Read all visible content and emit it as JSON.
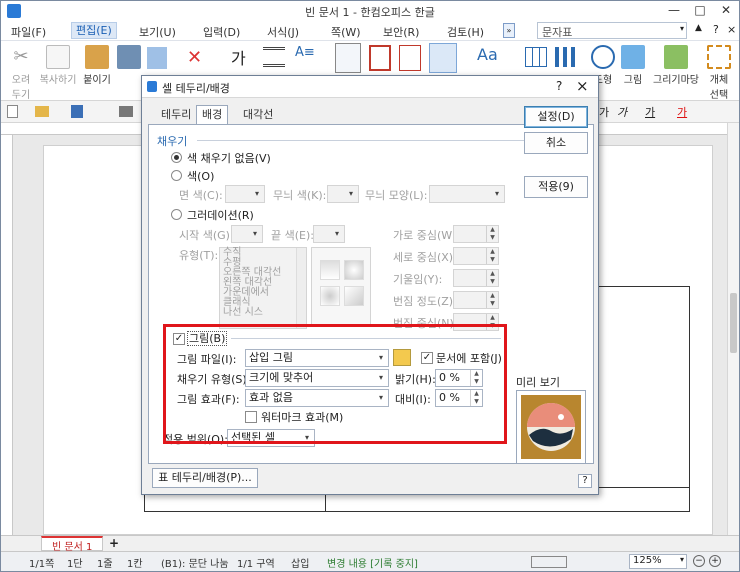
{
  "app": {
    "title": "빈 문서 1 - 한컴오피스 한글"
  },
  "menus": [
    {
      "label": "파일(F)"
    },
    {
      "label": "편집(E)"
    },
    {
      "label": "보기(U)"
    },
    {
      "label": "입력(D)"
    },
    {
      "label": "서식(J)"
    },
    {
      "label": "쪽(W)"
    },
    {
      "label": "보안(R)"
    },
    {
      "label": "검토(H)"
    }
  ],
  "style_box": "문자표",
  "ribbon": {
    "cut": "오려\n두기",
    "copy": "복사하기",
    "paste": "붙이기",
    "format_copy": "모양\n복사",
    "shape": "도형",
    "picture": "그림",
    "drawing": "그리기마당",
    "object_select": "개체\n선택"
  },
  "dialog": {
    "title": "셀 테두리/배경",
    "tabs": [
      {
        "label": "테두리"
      },
      {
        "label": "배경"
      },
      {
        "label": "대각선"
      }
    ],
    "fill_section": "채우기",
    "no_fill": "색 채우기 없음(V)",
    "color_radio": "색(O)",
    "face_color": "면 색(C):",
    "pattern_color": "무늬 색(K):",
    "pattern_shape": "무늬 모양(L):",
    "gradation_radio": "그러데이션(R)",
    "start_color": "시작 색(G):",
    "end_color": "끝 색(E):",
    "horizontal_center": "가로 중심(W):",
    "type_label": "유형(T):",
    "gradation_types": [
      "수직",
      "수평",
      "오른쪽 대각선",
      "왼쪽 대각선",
      "가운데에서",
      "클래식",
      "나선 시스"
    ],
    "vertical_center": "세로 중심(X):",
    "tilt": "기울임(Y):",
    "change_degree": "번짐 정도(Z):",
    "change_center": "번짐 중심(N):",
    "picture_check": "그림(B)",
    "picture_file_label": "그림 파일(I):",
    "picture_file_value": "삽입 그림",
    "include_in_doc": "문서에 포함(J)",
    "fill_type_label": "채우기 유형(S):",
    "fill_type_value": "크기에 맞추어",
    "brightness_label": "밝기(H):",
    "brightness_value": "0 %",
    "picture_effect_label": "그림 효과(F):",
    "picture_effect_value": "효과 없음",
    "contrast_label": "대비(I):",
    "contrast_value": "0 %",
    "watermark": "워터마크 효과(M)",
    "apply_range_label": "적용 범위(O):",
    "apply_range_value": "선택된 셀",
    "preview_label": "미리 보기",
    "table_border_btn": "표 테두리/배경(P)...",
    "set_btn": "설정(D)",
    "cancel_btn": "취소",
    "apply_btn": "적용(9)",
    "help": "?",
    "close": "×"
  },
  "doc_tab": "빈 문서 1",
  "status": {
    "page": "1/1쪽",
    "section": "1단",
    "line": "1줄",
    "col": "1칸",
    "para": "(B1): 문단 나눔",
    "zone": "1/1 구역",
    "insert": "삽입",
    "track": "변경 내용 [기록 중지]",
    "zoom": "125%"
  }
}
